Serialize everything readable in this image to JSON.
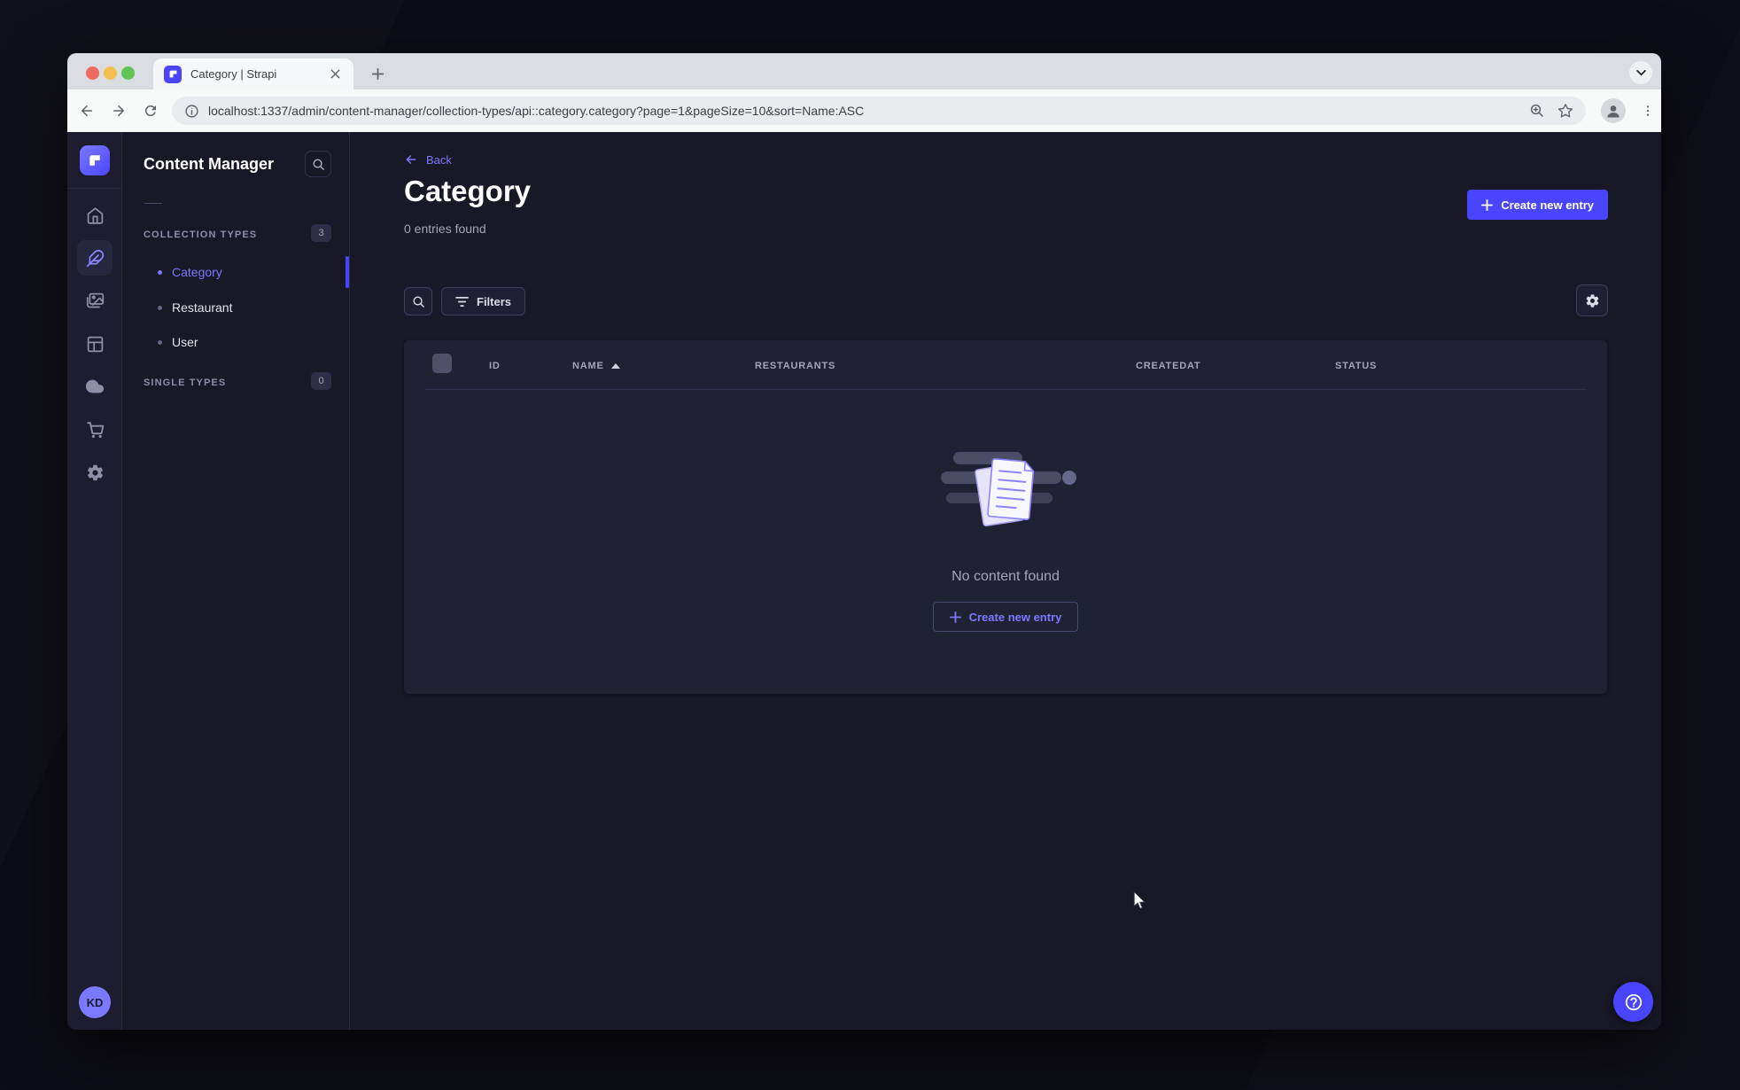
{
  "browser": {
    "tab_title": "Category | Strapi",
    "url": "localhost:1337/admin/content-manager/collection-types/api::category.category?page=1&pageSize=10&sort=Name:ASC",
    "traffic_lights": [
      "close",
      "minimize",
      "maximize"
    ],
    "toolbar_icons": [
      "back-arrow",
      "forward-arrow",
      "reload",
      "info",
      "zoom-in",
      "bookmark-star",
      "profile",
      "overflow-menu"
    ]
  },
  "nav_rail": {
    "icons": [
      "home",
      "content-manager",
      "media-library",
      "content-type-builder",
      "cloud",
      "marketplace",
      "settings"
    ],
    "active_icon": "content-manager",
    "user_initials": "KD"
  },
  "subnav": {
    "title": "Content Manager",
    "collection_types": {
      "label": "COLLECTION TYPES",
      "badge": "3",
      "items": [
        {
          "label": "Category",
          "active": true
        },
        {
          "label": "Restaurant",
          "active": false
        },
        {
          "label": "User",
          "active": false
        }
      ]
    },
    "single_types": {
      "label": "SINGLE TYPES",
      "badge": "0"
    }
  },
  "page": {
    "back_label": "Back",
    "title": "Category",
    "subtitle": "0 entries found",
    "create_button": "Create new entry",
    "filters_button": "Filters"
  },
  "table": {
    "columns": [
      "ID",
      "NAME",
      "RESTAURANTS",
      "CREATEDAT",
      "STATUS"
    ],
    "sort": {
      "column": "NAME",
      "direction": "ASC"
    },
    "rows": [],
    "empty_state": {
      "message": "No content found",
      "cta": "Create new entry"
    }
  },
  "colors": {
    "primary": "#4945ff",
    "primary_light": "#7b79ff",
    "app_bg": "#181826",
    "surface": "#212134"
  }
}
